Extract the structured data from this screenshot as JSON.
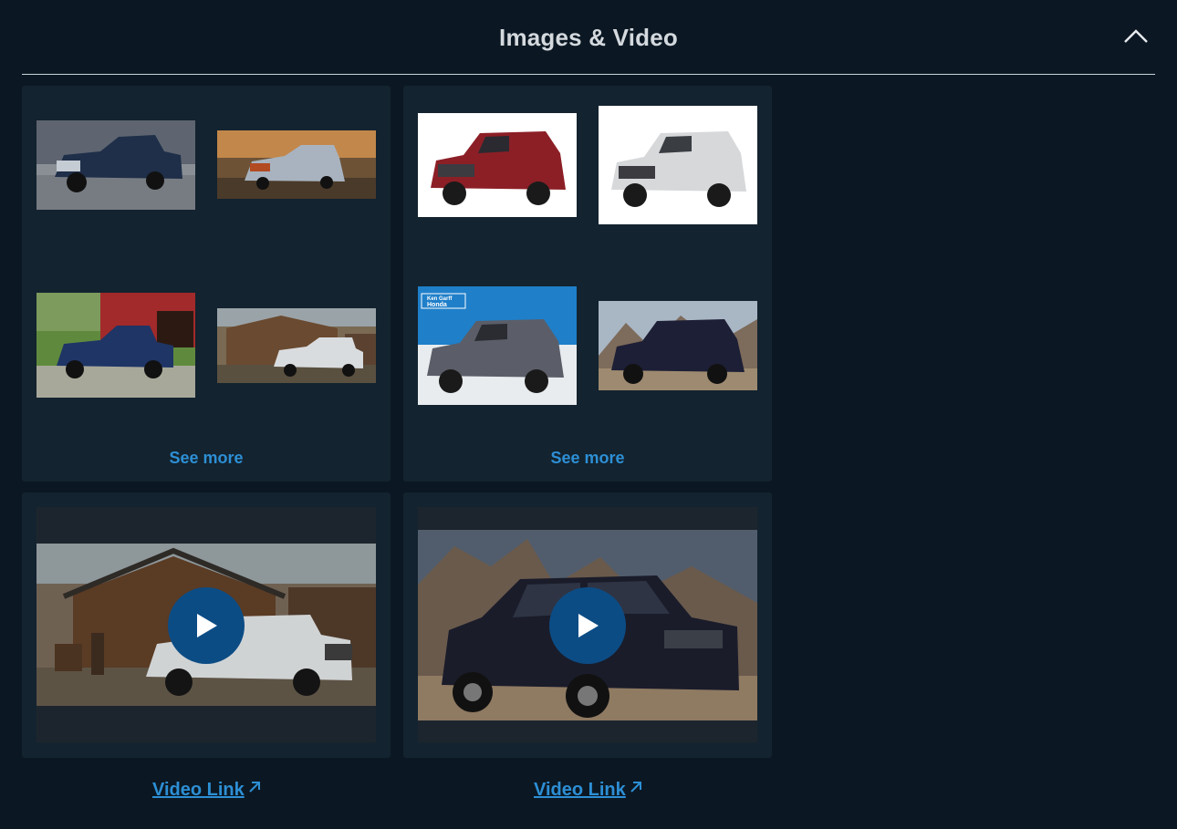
{
  "section": {
    "title": "Images & Video",
    "collapse_icon": "chevron-up-icon"
  },
  "image_groups": [
    {
      "vehicle": "truck",
      "images": [
        "truck-front-road",
        "truck-towing-sunset",
        "truck-barn-field",
        "truck-wooden-barn"
      ],
      "see_more_label": "See more"
    },
    {
      "vehicle": "suv",
      "images": [
        "suv-red-studio",
        "suv-white-studio",
        "suv-gray-dealer-banner",
        "suv-dark-mountains"
      ],
      "see_more_label": "See more"
    }
  ],
  "videos": [
    {
      "thumbnail": "truck-wooden-barn",
      "link_label": "Video Link",
      "link_icon": "external-link-icon"
    },
    {
      "thumbnail": "suv-dark-mountains",
      "link_label": "Video Link",
      "link_icon": "external-link-icon"
    }
  ],
  "dealer_banner": {
    "brand_line1": "Ken Garff",
    "brand_line2": "Honda"
  },
  "colors": {
    "background": "#0b1823",
    "card": "#13232f",
    "link": "#2d8fd5",
    "play_button": "#0c4c85",
    "title": "#d4d9de"
  }
}
